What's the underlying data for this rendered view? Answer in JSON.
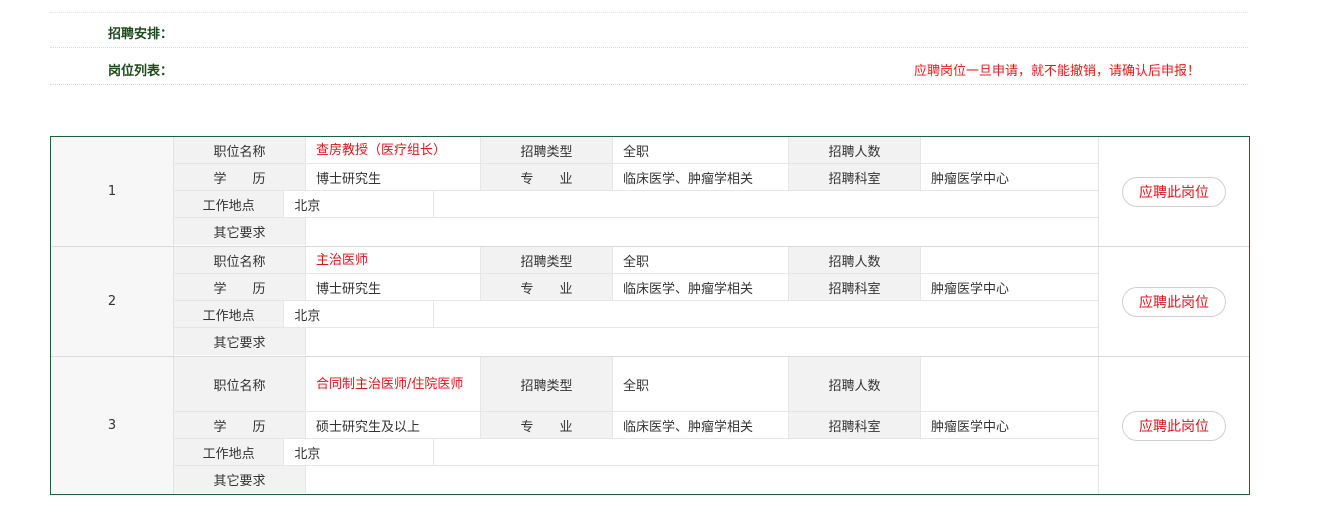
{
  "header": {
    "arrangement_label": "招聘安排：",
    "positions_label": "岗位列表：",
    "notice": "应聘岗位一旦申请，就不能撤销，请确认后申报！"
  },
  "labels": {
    "position_name": "职位名称",
    "recruit_type": "招聘类型",
    "headcount": "招聘人数",
    "education": "学　　历",
    "major": "专　　业",
    "department": "招聘科室",
    "location": "工作地点",
    "other_requirements": "其它要求"
  },
  "apply_button_label": "应聘此岗位",
  "jobs": [
    {
      "index": "1",
      "position_name": "查房教授（医疗组长）",
      "recruit_type": "全职",
      "headcount": "",
      "education": "博士研究生",
      "major": "临床医学、肿瘤学相关",
      "department": "肿瘤医学中心",
      "location": "北京",
      "other_requirements": ""
    },
    {
      "index": "2",
      "position_name": "主治医师",
      "recruit_type": "全职",
      "headcount": "",
      "education": "博士研究生",
      "major": "临床医学、肿瘤学相关",
      "department": "肿瘤医学中心",
      "location": "北京",
      "other_requirements": ""
    },
    {
      "index": "3",
      "position_name": "合同制主治医师/住院医师",
      "recruit_type": "全职",
      "headcount": "",
      "education": "硕士研究生及以上",
      "major": "临床医学、肿瘤学相关",
      "department": "肿瘤医学中心",
      "location": "北京",
      "other_requirements": ""
    }
  ],
  "colors": {
    "accent_red": "#d9161c",
    "frame_green": "#1f5e3a",
    "label_green": "#1d4a1d",
    "label_bg": "#f2f2f2"
  }
}
